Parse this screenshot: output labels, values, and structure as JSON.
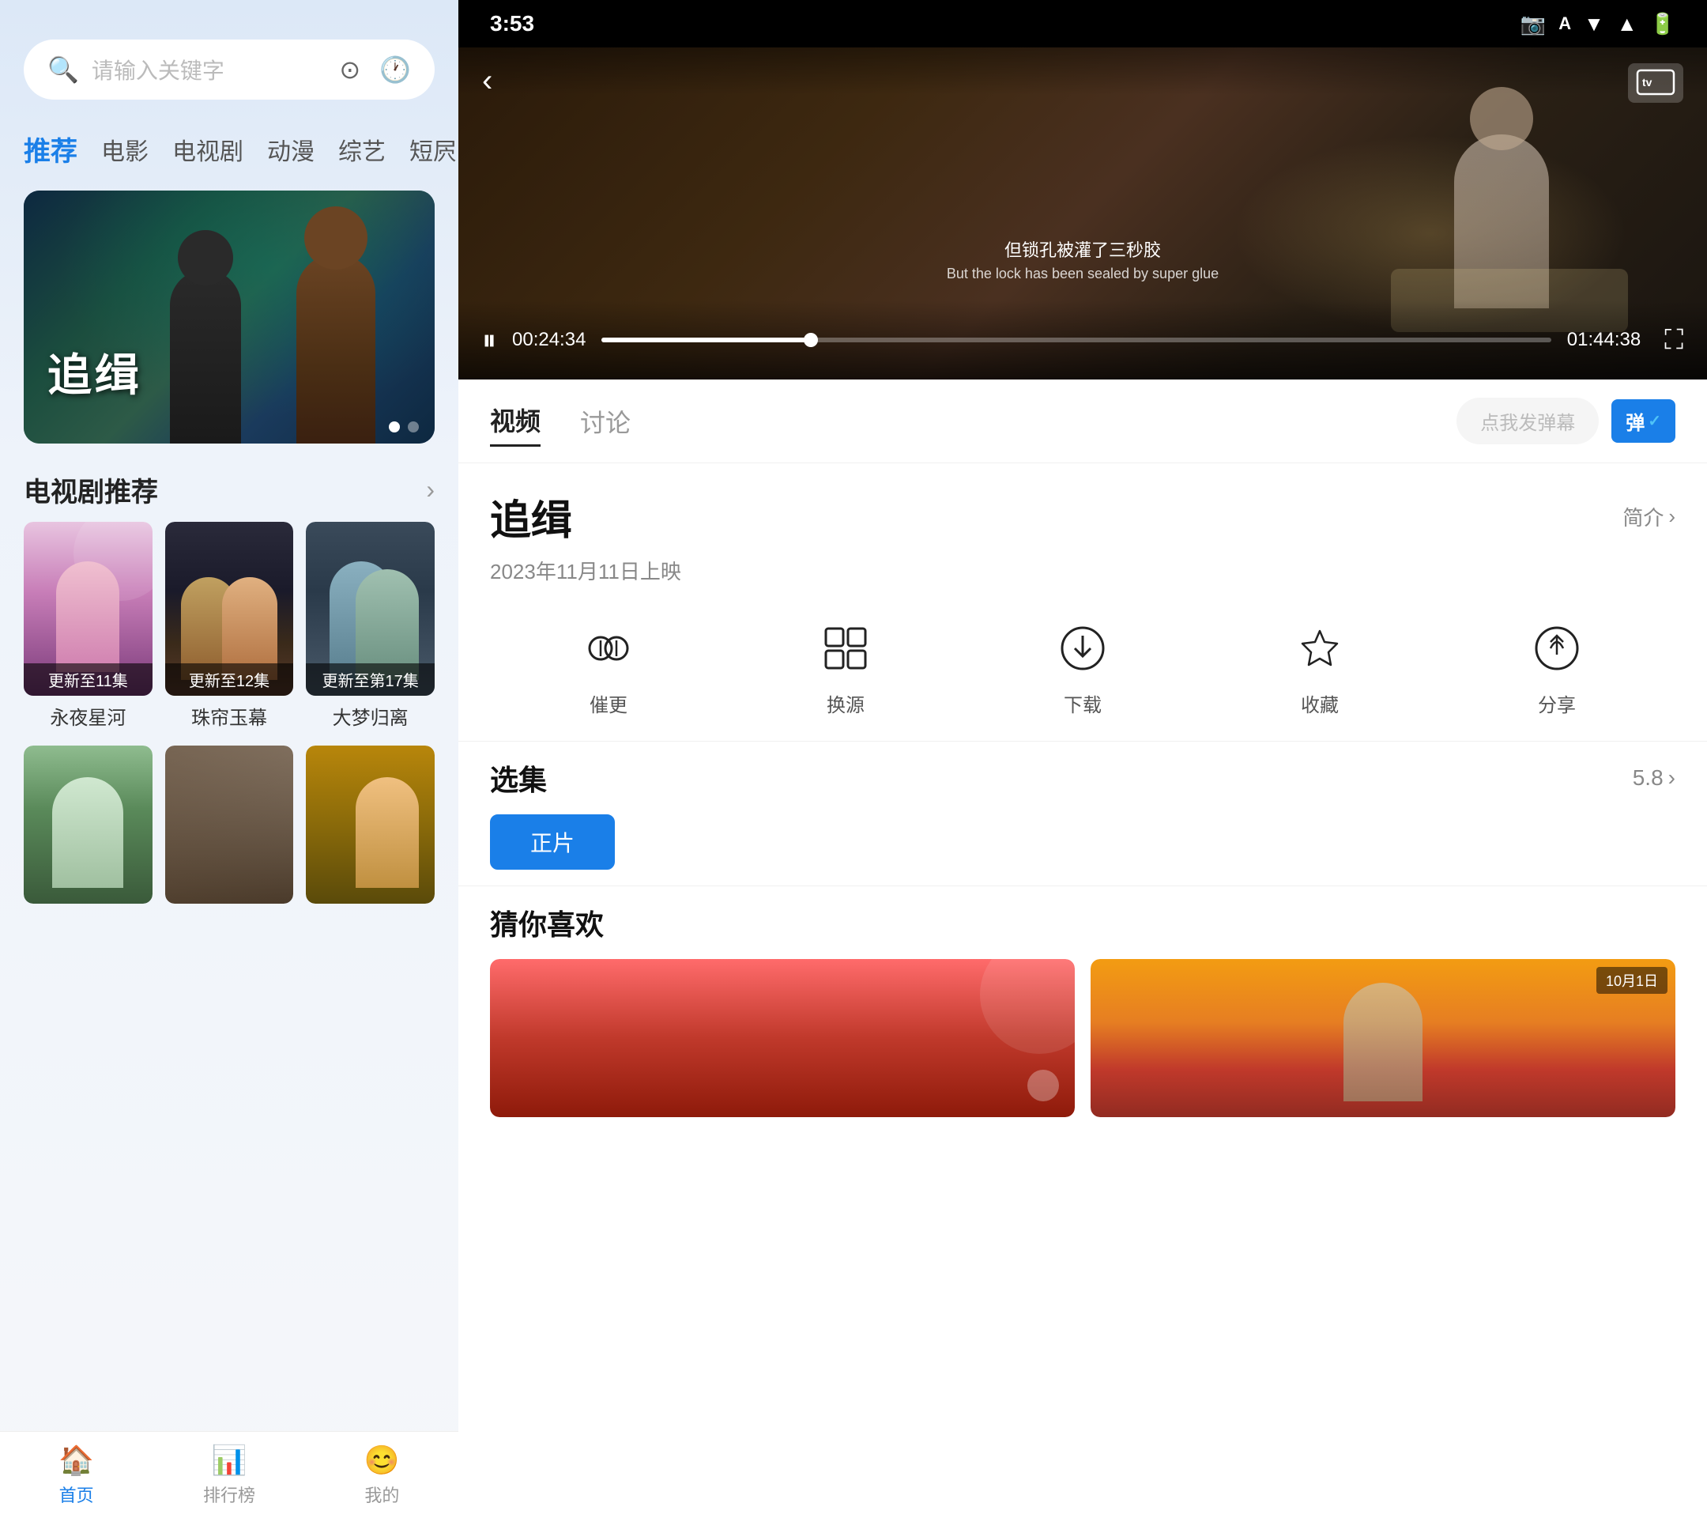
{
  "left": {
    "search": {
      "placeholder": "请输入关键字"
    },
    "nav_tabs": [
      {
        "label": "推荐",
        "active": true
      },
      {
        "label": "电影",
        "active": false
      },
      {
        "label": "电视剧",
        "active": false
      },
      {
        "label": "动漫",
        "active": false
      },
      {
        "label": "综艺",
        "active": false
      },
      {
        "label": "短屄",
        "active": false
      }
    ],
    "hero": {
      "title": "追缉",
      "subtitle": "追缉"
    },
    "tv_section": {
      "title": "电视剧推荐",
      "more": "›",
      "cards": [
        {
          "title": "永夜星河",
          "update": "更新至11集"
        },
        {
          "title": "珠帘玉幕",
          "update": "更新至12集"
        },
        {
          "title": "大梦归离",
          "update": "更新至第17集"
        }
      ],
      "cards2": [
        {
          "title": "",
          "update": ""
        },
        {
          "title": "",
          "update": ""
        },
        {
          "title": "",
          "update": ""
        }
      ]
    },
    "bottom_nav": [
      {
        "label": "首页",
        "icon": "🏠",
        "active": true
      },
      {
        "label": "排行榜",
        "icon": "📊",
        "active": false
      },
      {
        "label": "我的",
        "icon": "😊",
        "active": false
      }
    ]
  },
  "right": {
    "status_bar": {
      "time": "3:53",
      "icons": [
        "📷",
        "A",
        "▼",
        "📶",
        "🔋"
      ]
    },
    "player": {
      "subtitle_cn": "但锁孔被灌了三秒胶",
      "subtitle_en": "But the lock has been sealed by super glue",
      "time_current": "00:24:34",
      "time_total": "01:44:38",
      "progress_pct": 22
    },
    "tabs": [
      {
        "label": "视频",
        "active": true
      },
      {
        "label": "讨论",
        "active": false
      }
    ],
    "danmu": {
      "placeholder": "点我发弹幕",
      "btn_label": "弹"
    },
    "show": {
      "title": "追缉",
      "intro_label": "简介",
      "date": "2023年11月11日上映",
      "actions": [
        {
          "icon": "🎧",
          "label": "催更"
        },
        {
          "icon": "⚙",
          "label": "换源"
        },
        {
          "icon": "⬇",
          "label": "下载"
        },
        {
          "icon": "☆",
          "label": "收藏"
        },
        {
          "icon": "↻",
          "label": "分享"
        }
      ]
    },
    "episodes": {
      "title": "选集",
      "rating": "5.8",
      "tabs": [
        {
          "label": "正片",
          "active": true
        }
      ]
    },
    "recommend": {
      "title": "猜你喜欢",
      "cards": [
        {
          "bg": "red"
        },
        {
          "bg": "orange"
        }
      ]
    }
  }
}
